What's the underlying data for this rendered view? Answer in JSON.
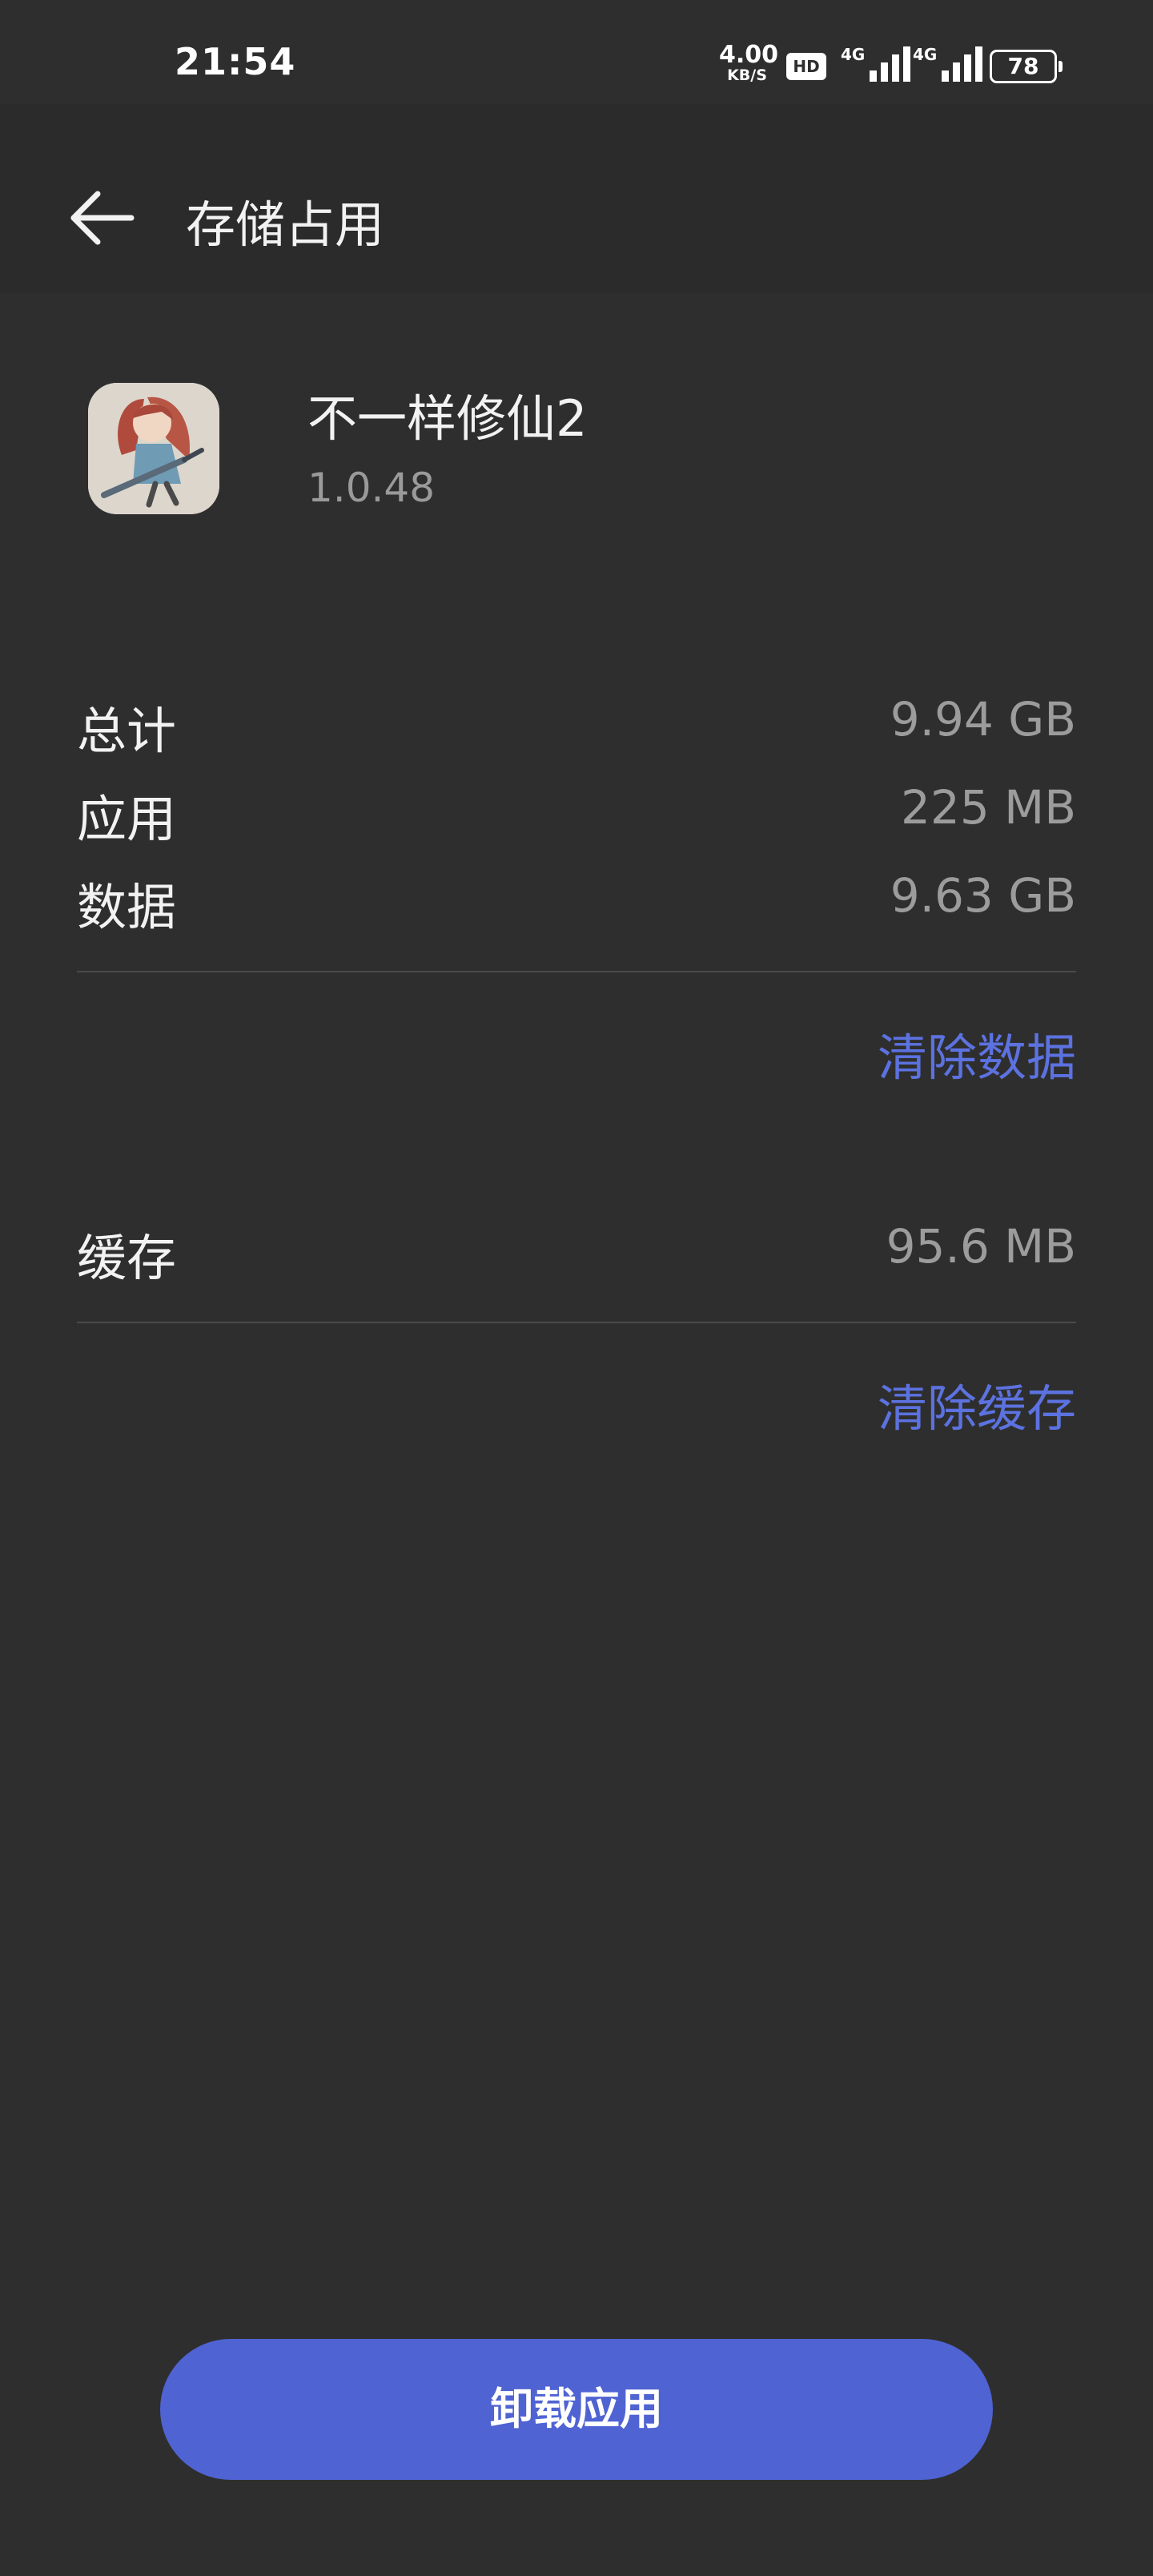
{
  "status_bar": {
    "time": "21:54",
    "net_speed_value": "4.00",
    "net_speed_unit": "KB/S",
    "hd_label": "HD",
    "signal1_tag": "4G",
    "signal2_tag": "4G",
    "battery": "78"
  },
  "header": {
    "title": "存储占用",
    "back_icon": "arrow-left-icon"
  },
  "app": {
    "name": "不一样修仙2",
    "version": "1.0.48",
    "icon": "app-icon-girl-with-sword"
  },
  "storage": {
    "total_label": "总计",
    "total_value": "9.94 GB",
    "app_label": "应用",
    "app_value": "225 MB",
    "data_label": "数据",
    "data_value": "9.63 GB",
    "clear_data_label": "清除数据",
    "cache_label": "缓存",
    "cache_value": "95.6 MB",
    "clear_cache_label": "清除缓存"
  },
  "actions": {
    "uninstall_label": "卸载应用"
  },
  "colors": {
    "background": "#2e2e2e",
    "accent": "#5c72e0",
    "button": "#4f63d2"
  }
}
